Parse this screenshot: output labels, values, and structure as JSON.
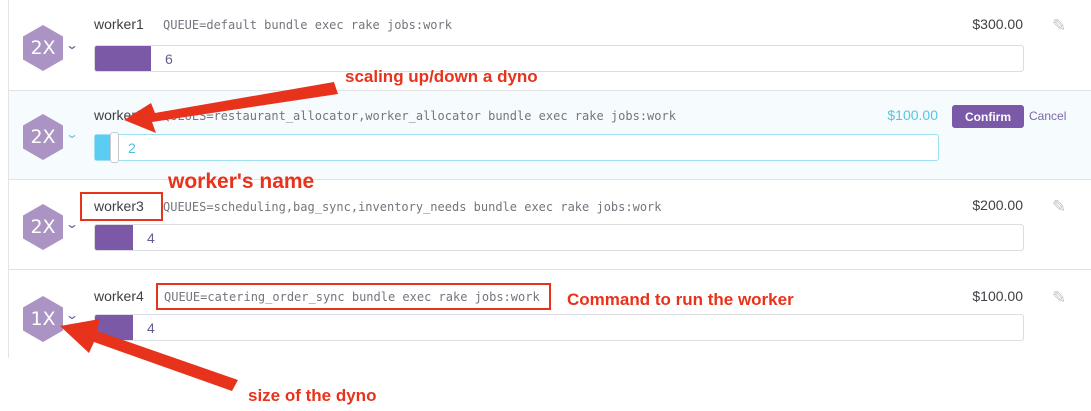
{
  "workers": [
    {
      "size": "2X",
      "name": "worker1",
      "command": "QUEUE=default bundle exec rake jobs:work",
      "price": "$300.00",
      "count": "6"
    },
    {
      "size": "2X",
      "name": "worker2",
      "command": "QUEUES=restaurant_allocator,worker_allocator bundle exec rake jobs:work",
      "price": "$100.00",
      "count": "2",
      "confirm_label": "Confirm",
      "cancel_label": "Cancel"
    },
    {
      "size": "2X",
      "name": "worker3",
      "command": "QUEUES=scheduling,bag_sync,inventory_needs bundle exec rake jobs:work",
      "price": "$200.00",
      "count": "4"
    },
    {
      "size": "1X",
      "name": "worker4",
      "command": "QUEUE=catering_order_sync bundle exec rake jobs:work",
      "price": "$100.00",
      "count": "4"
    }
  ],
  "annotations": {
    "scaling": "scaling up/down a dyno",
    "name": "worker's name",
    "command": "Command to run the worker",
    "size": "size of the dyno"
  },
  "icons": {
    "edit": "pencil-icon",
    "dropdown": "chevron-down-icon"
  },
  "colors": {
    "purple": "#7b59a6",
    "hex": "#ab94c3",
    "blue": "#5bcdf2",
    "annotation": "#e8331c"
  }
}
